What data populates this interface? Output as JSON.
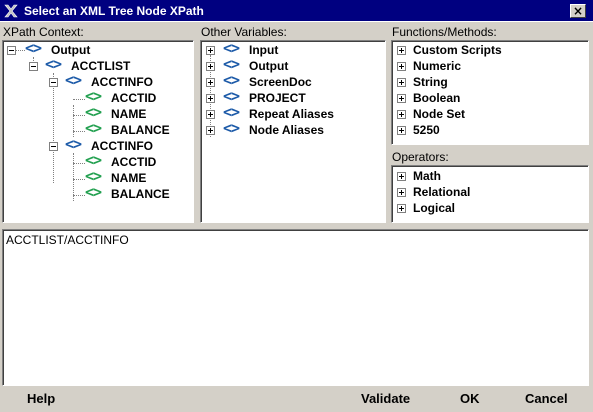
{
  "window": {
    "title": "Select an XML Tree Node XPath",
    "close_label": "×",
    "icon": "app-logo-icon"
  },
  "xpath_context": {
    "label": "XPath Context:",
    "nodes": [
      {
        "label": "Output",
        "icon": "xml-node-icon",
        "color": "#1c5aa8",
        "expander": "minus"
      },
      {
        "label": "ACCTLIST",
        "icon": "xml-node-icon",
        "color": "#1c5aa8",
        "expander": "minus"
      },
      {
        "label": "ACCTINFO",
        "icon": "xml-node-icon",
        "color": "#1c5aa8",
        "expander": "minus"
      },
      {
        "label": "ACCTID",
        "icon": "xml-leaf-icon",
        "color": "#22a050"
      },
      {
        "label": "NAME",
        "icon": "xml-leaf-icon",
        "color": "#22a050"
      },
      {
        "label": "BALANCE",
        "icon": "xml-leaf-icon",
        "color": "#22a050"
      },
      {
        "label": "ACCTINFO",
        "icon": "xml-node-icon",
        "color": "#1c5aa8",
        "expander": "minus"
      },
      {
        "label": "ACCTID",
        "icon": "xml-leaf-icon",
        "color": "#22a050"
      },
      {
        "label": "NAME",
        "icon": "xml-leaf-icon",
        "color": "#22a050"
      },
      {
        "label": "BALANCE",
        "icon": "xml-leaf-icon",
        "color": "#22a050"
      }
    ]
  },
  "other_variables": {
    "label": "Other Variables:",
    "items": [
      "Input",
      "Output",
      "ScreenDoc",
      "PROJECT",
      "Repeat Aliases",
      "Node Aliases"
    ]
  },
  "functions": {
    "label": "Functions/Methods:",
    "items": [
      "Custom Scripts",
      "Numeric",
      "String",
      "Boolean",
      "Node Set",
      "5250"
    ]
  },
  "operators": {
    "label": "Operators:",
    "items": [
      "Math",
      "Relational",
      "Logical"
    ]
  },
  "xpath_value": "ACCTLIST/ACCTINFO",
  "buttons": {
    "help": "Help",
    "validate": "Validate",
    "ok": "OK",
    "cancel": "Cancel"
  },
  "colors": {
    "title_bar": "#000080",
    "dialog_bg": "#d4d0c8",
    "node_blue": "#1c5aa8",
    "node_green": "#22a050"
  }
}
